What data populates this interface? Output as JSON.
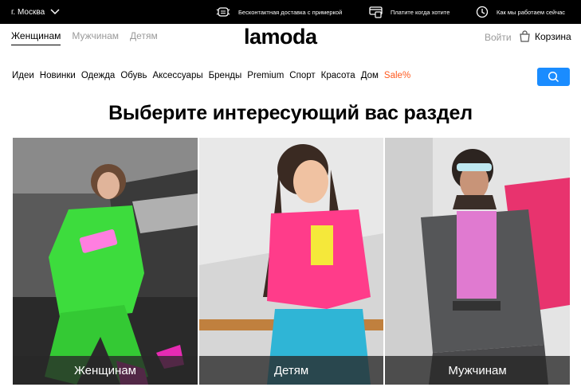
{
  "topbar": {
    "city": "г. Москва",
    "promos": [
      {
        "icon": "mask-icon",
        "text": "Бесконтактная доставка с примеркой"
      },
      {
        "icon": "card-terminal-icon",
        "text": "Платите когда хотите"
      },
      {
        "icon": "clock-icon",
        "text": "Как мы работаем сейчас"
      }
    ]
  },
  "header": {
    "gender_tabs": [
      "Женщинам",
      "Мужчинам",
      "Детям"
    ],
    "active_tab": "Женщинам",
    "logo": "lamoda",
    "login": "Войти",
    "cart": "Корзина"
  },
  "nav": {
    "items": [
      "Идеи",
      "Новинки",
      "Одежда",
      "Обувь",
      "Аксессуары",
      "Бренды",
      "Premium",
      "Спорт",
      "Красота",
      "Дом",
      "Sale%"
    ]
  },
  "main": {
    "title": "Выберите интересующий вас раздел",
    "tiles": [
      {
        "label": "Женщинам"
      },
      {
        "label": "Детям"
      },
      {
        "label": "Мужчинам"
      }
    ]
  },
  "colors": {
    "topbar": "#000000",
    "search_button": "#1a8cff",
    "sale": "#ff5a1f",
    "muted_text": "#9a9a9a"
  }
}
